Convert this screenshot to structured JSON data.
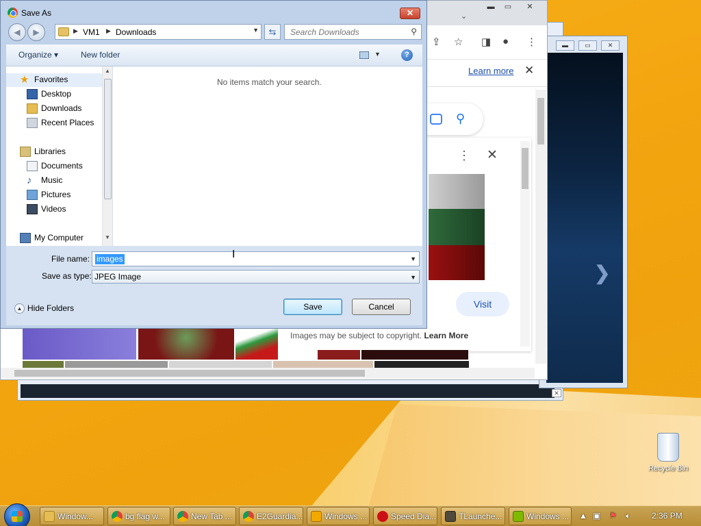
{
  "dialog": {
    "title": "Save As",
    "breadcrumb": [
      "VM1",
      "Downloads"
    ],
    "search_placeholder": "Search Downloads",
    "organize_label": "Organize ▾",
    "new_folder_label": "New folder",
    "help_label": "?",
    "empty_message": "No items match your search.",
    "file_name_label": "File name:",
    "file_name_value": "images",
    "save_as_type_label": "Save as type:",
    "save_as_type_value": "JPEG Image",
    "hide_folders_label": "Hide Folders",
    "save_label": "Save",
    "cancel_label": "Cancel"
  },
  "nav_pane": {
    "favorites": "Favorites",
    "desktop": "Desktop",
    "downloads": "Downloads",
    "recent_places": "Recent Places",
    "libraries": "Libraries",
    "documents": "Documents",
    "music": "Music",
    "pictures": "Pictures",
    "videos": "Videos",
    "my_computer": "My Computer"
  },
  "browser": {
    "learn_more_link": "Learn more",
    "visit_label": "Visit",
    "copyright_text": "Images may be subject to copyright.",
    "copyright_link": "Learn More"
  },
  "desktop": {
    "recycle_bin": "Recycle Bin"
  },
  "taskbar": {
    "items": [
      "Window...",
      "bg flag w...",
      "New Tab ...",
      "E2Guardia...",
      "Windows ...",
      "Speed Dia...",
      "TLaunche...",
      "Windows ..."
    ],
    "clock": "2:36 PM"
  },
  "colors": {
    "accent": "#1a73e8",
    "selection": "#3399ff",
    "desktop": "#f3a510",
    "close_red": "#c7432c"
  }
}
